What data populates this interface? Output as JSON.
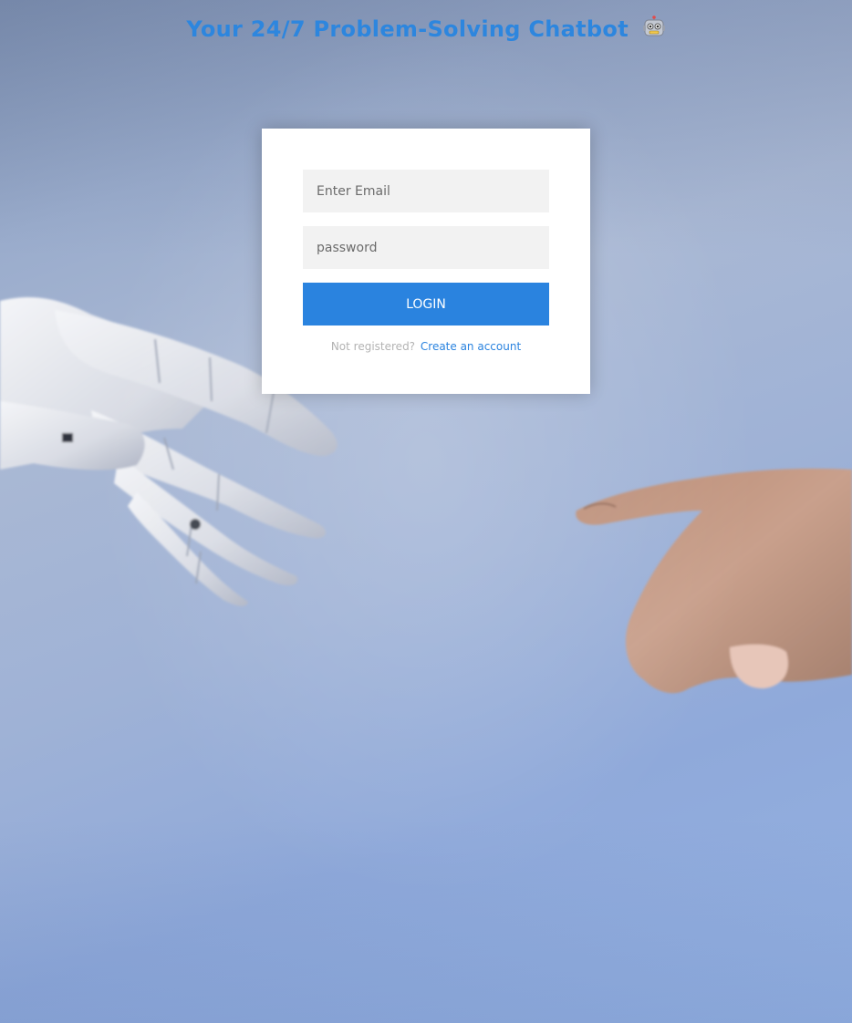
{
  "header": {
    "title": "Your 24/7 Problem-Solving Chatbot",
    "title_icon": "robot-face-icon"
  },
  "login_form": {
    "email_placeholder": "Enter Email",
    "password_placeholder": "password",
    "login_label": "LOGIN",
    "register_prompt": "Not registered?",
    "register_link": "Create an account"
  },
  "colors": {
    "accent": "#2a83df",
    "title": "#2d86de",
    "card": "#ffffff",
    "field_bg": "#f2f2f2",
    "muted_text": "#b3b3b3"
  },
  "background": {
    "image_subject": "robot hand reaching toward human hand"
  }
}
